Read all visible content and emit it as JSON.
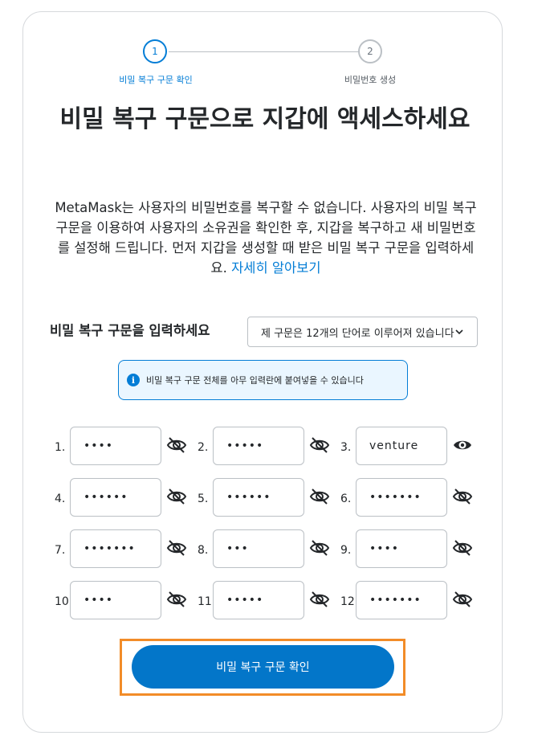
{
  "stepper": {
    "step1_number": "1",
    "step1_label": "비밀 복구 구문 확인",
    "step2_number": "2",
    "step2_label": "비밀번호 생성"
  },
  "title": "비밀 복구 구문으로 지갑에 액세스하세요",
  "description": {
    "text": "MetaMask는 사용자의 비밀번호를 복구할 수 없습니다. 사용자의 비밀 복구 구문을 이용하여 사용자의 소유권을 확인한 후, 지갑을 복구하고 새 비밀번호를 설정해 드립니다. 먼저 지갑을 생성할 때 받은 비밀 복구 구문을 입력하세요. ",
    "link": "자세히 알아보기"
  },
  "srp": {
    "label": "비밀 복구 구문을 입력하세요",
    "dropdown_value": "제 구문은 12개의 단어로 이루어져 있습니다"
  },
  "notice": {
    "icon": "info-icon",
    "text": "비밀 복구 구문 전체를 아무 입력란에 붙여넣을 수 있습니다"
  },
  "words": [
    {
      "num": "1.",
      "value": "••••",
      "eye": "eye-slash-icon"
    },
    {
      "num": "2.",
      "value": "•••••",
      "eye": "eye-slash-icon"
    },
    {
      "num": "3.",
      "value": "venture",
      "eye": "eye-icon"
    },
    {
      "num": "4.",
      "value": "••••••",
      "eye": "eye-slash-icon"
    },
    {
      "num": "5.",
      "value": "••••••",
      "eye": "eye-slash-icon"
    },
    {
      "num": "6.",
      "value": "•••••••",
      "eye": "eye-slash-icon"
    },
    {
      "num": "7.",
      "value": "•••••••",
      "eye": "eye-slash-icon"
    },
    {
      "num": "8.",
      "value": "•••",
      "eye": "eye-slash-icon"
    },
    {
      "num": "9.",
      "value": "••••",
      "eye": "eye-slash-icon"
    },
    {
      "num": "10.",
      "value": "••••",
      "eye": "eye-slash-icon"
    },
    {
      "num": "11.",
      "value": "•••••",
      "eye": "eye-slash-icon"
    },
    {
      "num": "12.",
      "value": "•••••••",
      "eye": "eye-slash-icon"
    }
  ],
  "submit_label": "비밀 복구 구문 확인",
  "colors": {
    "accent": "#037dd6",
    "button": "#0376c9",
    "highlight": "#f28c28"
  }
}
